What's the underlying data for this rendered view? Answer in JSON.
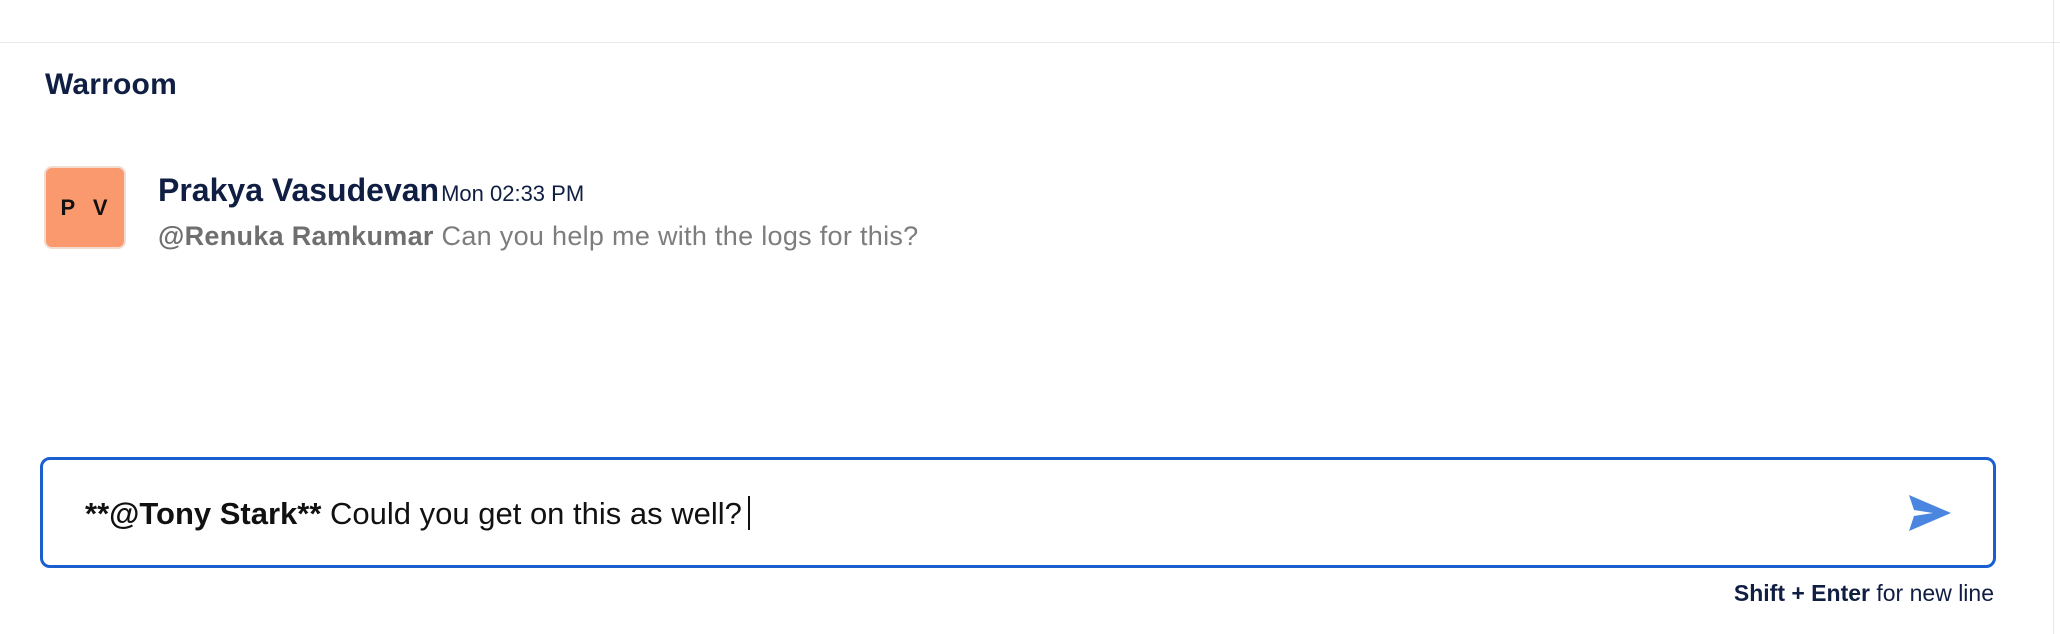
{
  "panel": {
    "title": "Warroom"
  },
  "messages": [
    {
      "avatar_initials": "P V",
      "avatar_color": "#f9996d",
      "author": "Prakya Vasudevan",
      "timestamp": "Mon 02:33 PM",
      "mention": "@Renuka Ramkumar",
      "text": " Can you help me with the logs for this?"
    }
  ],
  "composer": {
    "prefix": "**",
    "mention": "@Tony Stark",
    "suffix_marker": "**",
    "text": " Could you get on this as well?",
    "border_color": "#1a5fcf",
    "send_icon": "send-icon"
  },
  "hint": {
    "key_combo": "Shift + Enter",
    "text": " for new line"
  }
}
